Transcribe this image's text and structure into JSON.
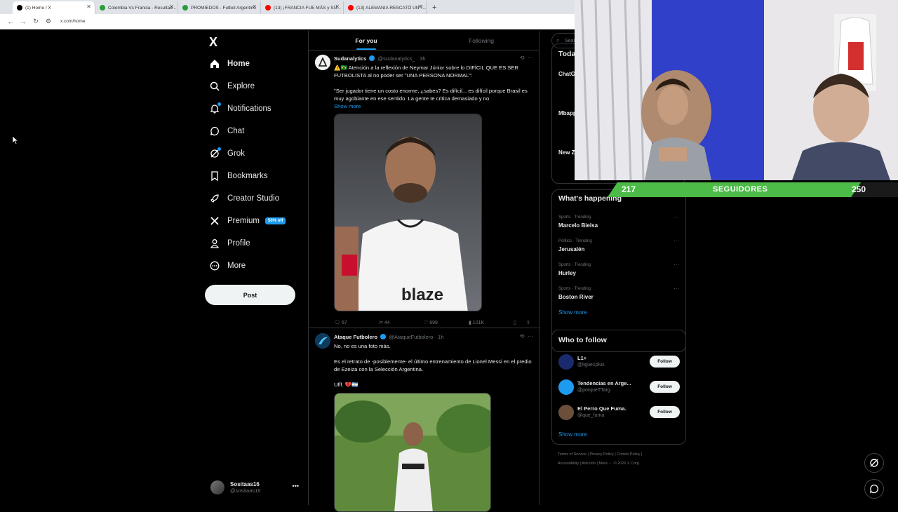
{
  "browser": {
    "tabs": [
      {
        "title": "(1) Home / X",
        "color": "#000000",
        "active": true
      },
      {
        "title": "Colombia Vs Francia - Resultad...",
        "color": "#2a9d3a",
        "active": false
      },
      {
        "title": "PROMIEDOS - Futbol Argentino",
        "color": "#2a9d3a",
        "active": false
      },
      {
        "title": "(13) ¡FRANCIA FUE MÁS y SU...",
        "color": "#ff0000",
        "active": false
      },
      {
        "title": "(13) ALEMANIA RESCATÓ UN T...",
        "color": "#ff0000",
        "active": false
      }
    ],
    "new_tab": "+",
    "url": "x.com/home"
  },
  "sidebar": {
    "logo": "X",
    "items": [
      {
        "label": "Home",
        "icon": "home-icon"
      },
      {
        "label": "Explore",
        "icon": "search-icon"
      },
      {
        "label": "Notifications",
        "icon": "bell-icon"
      },
      {
        "label": "Chat",
        "icon": "chat-icon"
      },
      {
        "label": "Grok",
        "icon": "grok-icon"
      },
      {
        "label": "Bookmarks",
        "icon": "bookmark-icon"
      },
      {
        "label": "Creator Studio",
        "icon": "rocket-icon"
      },
      {
        "label": "Premium",
        "icon": "x-logo-icon"
      },
      {
        "label": "Profile",
        "icon": "person-icon"
      },
      {
        "label": "More",
        "icon": "more-circle-icon"
      }
    ],
    "premium_badge": "50% off",
    "post_button": "Post",
    "account": {
      "name": "Sositaas16",
      "handle": "@sositaas16",
      "more": "•••"
    }
  },
  "timeline": {
    "tabs": [
      "For you",
      "Following"
    ],
    "tweets": [
      {
        "name": "Sudanalytics",
        "handle": "@sudanalytics_",
        "time": "· 3h",
        "text": "⚠️🇧🇷 Atención a la reflexión de Neymar Júnior sobre lo DIFÍCIL QUE ES SER FUTBOLISTA al no poder ser \"UNA PERSONA NORMAL\":",
        "text2": "\"Ser jugador tiene un costo enorme, ¿sabes? Es difícil... es difícil porque Brasil es muy agobiante en ese sentido. La gente te critica demasiado y no",
        "show_more": "Show more",
        "image_caption": "blaze",
        "replies": "67",
        "reposts": "44",
        "likes": "699",
        "views": "101K"
      },
      {
        "name": "Ataque Futbolero",
        "handle": "@AtaqueFutbolero",
        "time": "· 1h",
        "text": "No, no es una foto más.",
        "text2": "Es el retrato de -posiblemente- el último entrenamiento de Lionel Messi en el predio de Ezeiza con la Selección Argentina.",
        "text3": "Ufff. 💔🇦🇷"
      }
    ]
  },
  "right": {
    "search_placeholder": "Search",
    "today_title": "Today's News",
    "today_items": [
      "ChatGPT 2026",
      "Mbappé NBA 1",
      "New Z World"
    ],
    "happening_title": "What's happening",
    "trends": [
      {
        "category": "Sports · Trending",
        "name": "Marcelo Bielsa"
      },
      {
        "category": "Politics · Trending",
        "name": "Jerusalén"
      },
      {
        "category": "Sports · Trending",
        "name": "Hurley"
      },
      {
        "category": "Sports · Trending",
        "name": "Boston River"
      }
    ],
    "show_more": "Show more",
    "wtf_title": "Who to follow",
    "wtf": [
      {
        "name": "L1+",
        "handle": "@ligue1plus",
        "color": "#1a2a6c"
      },
      {
        "name": "Tendencias en Arge...",
        "handle": "@porqueTTarg",
        "color": "#1d9bf0"
      },
      {
        "name": "El Perro Que Fuma.",
        "handle": "@que_fuma",
        "color": "#6b4f3a"
      }
    ],
    "follow_label": "Follow",
    "footer_line1": "Terms of Service  |  Privacy Policy  |  Cookie Policy  |",
    "footer_line2": "Accessibility  |  Ads info  |  More ···  © 2026 X Corp."
  },
  "overlay": {
    "followers_current": "217",
    "followers_label": "SEGUIDORES",
    "followers_goal": "250",
    "followers_progress": 0.868,
    "bar_color": "#4cbb47"
  }
}
